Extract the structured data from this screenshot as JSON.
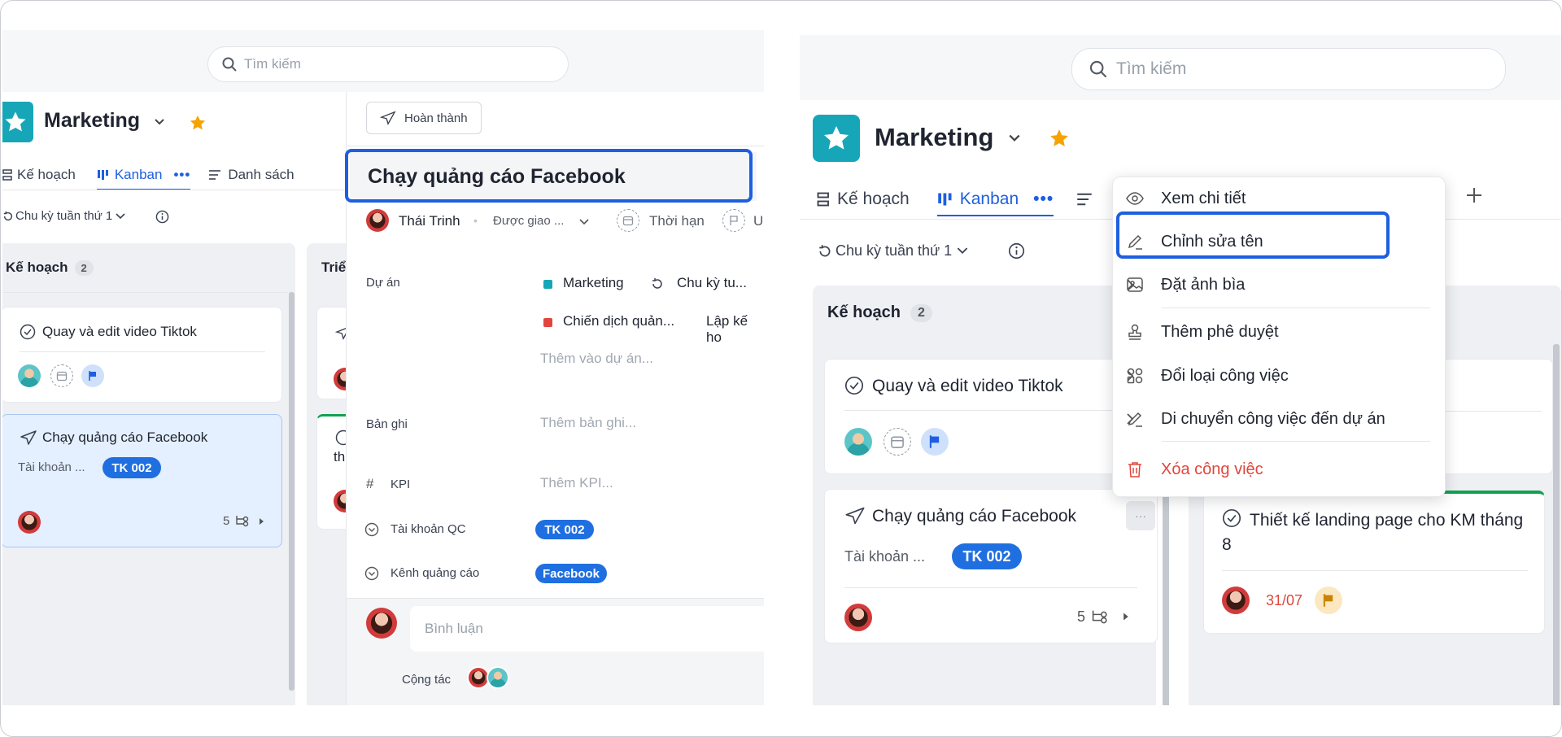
{
  "colors": {
    "accent": "#1d5fe0",
    "teal": "#17a6b8",
    "danger": "#e0463c",
    "star": "#f5a300"
  },
  "search": {
    "placeholder": "Tìm kiếm"
  },
  "project": {
    "name": "Marketing"
  },
  "tabs": {
    "plan": "Kế hoạch",
    "kanban": "Kanban",
    "list": "Danh sách"
  },
  "cycle": {
    "label": "Chu kỳ tuần thứ 1"
  },
  "columns": {
    "plan": {
      "name": "Kế hoạch",
      "count": "2"
    },
    "deploy_partial": "Triể"
  },
  "cards": {
    "video": {
      "title": "Quay và edit video Tiktok"
    },
    "fb": {
      "title": "Chạy quảng cáo Facebook",
      "field": "Tài khoản ...",
      "tag": "TK 002",
      "subtasks": "5"
    },
    "landing": {
      "title": "Thiết kế landing page cho KM tháng 8",
      "due": "31/07"
    },
    "partial_th": "th"
  },
  "detail": {
    "complete_btn": "Hoàn thành",
    "title": "Chạy quảng cáo Facebook",
    "assignee": "Thái Trinh",
    "assigned": "Được giao ...",
    "deadline": "Thời hạn",
    "priority_partial": "U",
    "project_label": "Dự án",
    "project1": "Marketing",
    "project1_cycle": "Chu kỳ tu...",
    "project2": "Chiến dịch quản...",
    "project2_col": "Lập kế ho",
    "add_project": "Thêm vào dự án...",
    "notes_label": "Bản ghi",
    "notes_placeholder": "Thêm bản ghi...",
    "kpi_label": "KPI",
    "kpi_placeholder": "Thêm KPI...",
    "account_label": "Tài khoản QC",
    "account_value": "TK 002",
    "channel_label": "Kênh quảng cáo",
    "channel_value": "Facebook",
    "comment_placeholder": "Bình luận",
    "collab_label": "Cộng tác"
  },
  "menu": {
    "view": "Xem chi tiết",
    "rename": "Chỉnh sửa tên",
    "cover": "Đặt ảnh bìa",
    "approval": "Thêm phê duyệt",
    "change_type": "Đổi loại công việc",
    "move": "Di chuyển công việc đến dự án",
    "delete": "Xóa công việc"
  }
}
